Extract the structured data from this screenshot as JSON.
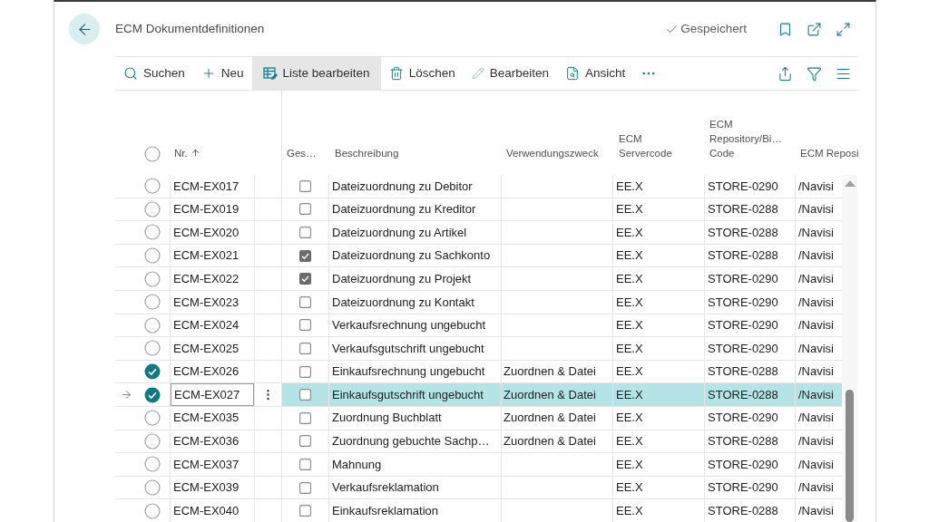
{
  "page": {
    "title": "ECM Dokumentdefinitionen",
    "save_status": "Gespeichert"
  },
  "toolbar": {
    "actions": [
      {
        "kind": "search",
        "label": "Suchen",
        "selected": false
      },
      {
        "kind": "new",
        "label": "Neu",
        "selected": false
      },
      {
        "kind": "edit_list",
        "label": "Liste bearbeiten",
        "selected": true
      },
      {
        "kind": "delete",
        "label": "Löschen",
        "selected": false
      },
      {
        "kind": "edit",
        "label": "Bearbeiten",
        "selected": false
      },
      {
        "kind": "view",
        "label": "Ansicht",
        "selected": false
      }
    ]
  },
  "table": {
    "all_selected": false,
    "columns": [
      {
        "label": "Nr.",
        "sorted": true
      },
      {
        "label": "Ges…",
        "sorted": false
      },
      {
        "label": "Beschreibung",
        "sorted": false
      },
      {
        "label": "Verwendungszweck",
        "sorted": false
      },
      {
        "label": "ECM Servercode",
        "sorted": false
      },
      {
        "label": "ECM Repository/Bi… Code",
        "sorted": false
      },
      {
        "label": "ECM Reposi",
        "sorted": false
      }
    ],
    "rows": [
      {
        "no": "ECM-EX017",
        "selected": false,
        "current": false,
        "checked": false,
        "description": "Dateizuordnung zu Debitor",
        "server": "EE.X",
        "repo_code": "STORE-0290",
        "repo": "/Navisi"
      },
      {
        "no": "ECM-EX019",
        "selected": false,
        "current": false,
        "checked": false,
        "description": "Dateizuordnung zu Kreditor",
        "server": "EE.X",
        "repo_code": "STORE-0288",
        "repo": "/Navisi"
      },
      {
        "no": "ECM-EX020",
        "selected": false,
        "current": false,
        "checked": false,
        "description": "Dateizuordnung zu Artikel",
        "server": "EE.X",
        "repo_code": "STORE-0288",
        "repo": "/Navisi"
      },
      {
        "no": "ECM-EX021",
        "selected": false,
        "current": false,
        "checked": true,
        "description": "Dateizuordnung zu Sachkonto",
        "server": "EE.X",
        "repo_code": "STORE-0288",
        "repo": "/Navisi"
      },
      {
        "no": "ECM-EX022",
        "selected": false,
        "current": false,
        "checked": true,
        "description": "Dateizuordnung zu Projekt",
        "server": "EE.X",
        "repo_code": "STORE-0290",
        "repo": "/Navisi"
      },
      {
        "no": "ECM-EX023",
        "selected": false,
        "current": false,
        "checked": false,
        "description": "Dateizuordnung zu Kontakt",
        "server": "EE.X",
        "repo_code": "STORE-0290",
        "repo": "/Navisi"
      },
      {
        "no": "ECM-EX024",
        "selected": false,
        "current": false,
        "checked": false,
        "description": "Verkaufsrechnung ungebucht",
        "server": "EE.X",
        "repo_code": "STORE-0290",
        "repo": "/Navisi"
      },
      {
        "no": "ECM-EX025",
        "selected": false,
        "current": false,
        "checked": false,
        "description": "Verkaufsgutschrift ungebucht",
        "server": "EE.X",
        "repo_code": "STORE-0290",
        "repo": "/Navisi"
      },
      {
        "no": "ECM-EX026",
        "selected": true,
        "current": false,
        "checked": false,
        "description": "Einkaufsrechnung ungebucht",
        "purpose": "Zuordnen & Datei",
        "server": "EE.X",
        "repo_code": "STORE-0288",
        "repo": "/Navisi"
      },
      {
        "no": "ECM-EX027",
        "selected": true,
        "current": true,
        "checked": false,
        "description": "Einkaufsgutschrift ungebucht",
        "purpose": "Zuordnen & Datei",
        "server": "EE.X",
        "repo_code": "STORE-0288",
        "repo": "/Navisi"
      },
      {
        "no": "ECM-EX035",
        "selected": false,
        "current": false,
        "checked": false,
        "description": "Zuordnung Buchblatt",
        "purpose": "Zuordnen & Datei",
        "server": "EE.X",
        "repo_code": "STORE-0290",
        "repo": "/Navisi"
      },
      {
        "no": "ECM-EX036",
        "selected": false,
        "current": false,
        "checked": false,
        "description": "Zuordnung gebuchte Sachp…",
        "purpose": "Zuordnen & Datei",
        "server": "EE.X",
        "repo_code": "STORE-0288",
        "repo": "/Navisi"
      },
      {
        "no": "ECM-EX037",
        "selected": false,
        "current": false,
        "checked": false,
        "description": "Mahnung",
        "server": "EE.X",
        "repo_code": "STORE-0290",
        "repo": "/Navisi"
      },
      {
        "no": "ECM-EX039",
        "selected": false,
        "current": false,
        "checked": false,
        "description": "Verkaufsreklamation",
        "server": "EE.X",
        "repo_code": "STORE-0290",
        "repo": "/Navisi"
      },
      {
        "no": "ECM-EX040",
        "selected": false,
        "current": false,
        "checked": false,
        "description": "Einkaufsreklamation",
        "server": "EE.X",
        "repo_code": "STORE-0288",
        "repo": "/Navisi"
      }
    ]
  }
}
